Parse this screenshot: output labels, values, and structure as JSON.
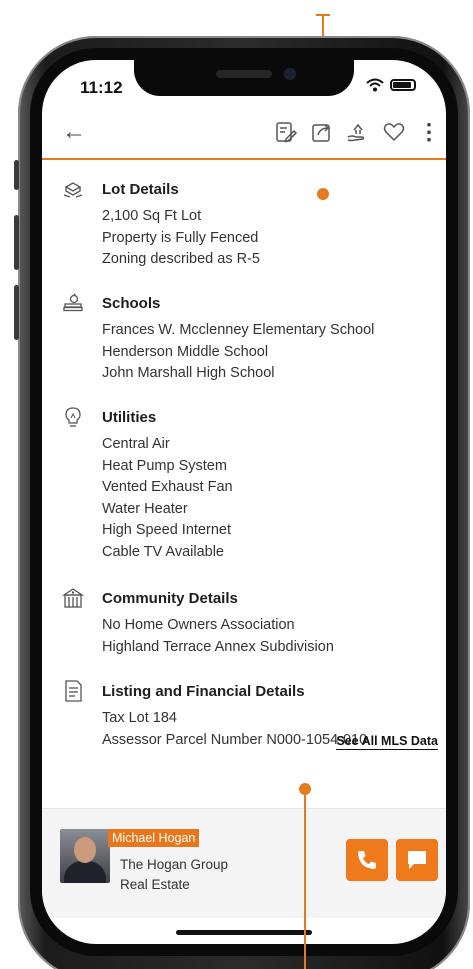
{
  "status": {
    "time": "11:12"
  },
  "toolbar": {
    "back": "←",
    "more": "⋮"
  },
  "sections": [
    {
      "title": "Lot Details",
      "icon": "lot-icon",
      "lines": [
        "2,100 Sq Ft Lot",
        "Property is Fully Fenced",
        "Zoning described as R-5"
      ]
    },
    {
      "title": "Schools",
      "icon": "school-icon",
      "lines": [
        "Frances W. Mcclenney Elementary School",
        "Henderson Middle School",
        "John Marshall High School"
      ]
    },
    {
      "title": "Utilities",
      "icon": "lightbulb-icon",
      "lines": [
        "Central Air",
        "Heat Pump System",
        "Vented Exhaust Fan",
        "Water Heater",
        "High Speed Internet",
        "Cable TV Available"
      ]
    },
    {
      "title": "Community Details",
      "icon": "community-icon",
      "lines": [
        "No Home Owners Association",
        "Highland Terrace Annex Subdivision"
      ]
    },
    {
      "title": "Listing and Financial Details",
      "icon": "document-icon",
      "lines": [
        "Tax Lot 184",
        "Assessor Parcel Number N000-1054-010"
      ]
    }
  ],
  "see_all": "See All MLS Data",
  "agent": {
    "name": "Michael Hogan",
    "company_line1": "The Hogan Group",
    "company_line2": "Real Estate"
  },
  "colors": {
    "accent": "#e8761c"
  }
}
